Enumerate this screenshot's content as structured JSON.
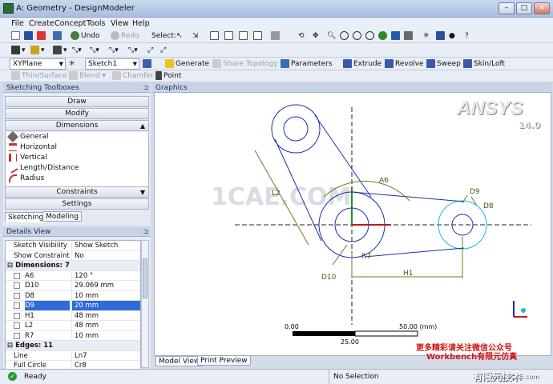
{
  "window": {
    "title": "A: Geometry - DesignModeler",
    "min": "–",
    "max": "□",
    "close": "×"
  },
  "menu": [
    "File",
    "Create",
    "Concept",
    "Tools",
    "View",
    "Help"
  ],
  "toolbar1": {
    "undo": "Undo",
    "redo": "Redo",
    "select": "Select:"
  },
  "toolbar2": {
    "plane": "XYPlane",
    "sketch": "Sketch1",
    "generate": "Generate",
    "share_topology": "Share Topology",
    "parameters": "Parameters",
    "extrude": "Extrude",
    "revolve": "Revolve",
    "sweep": "Sweep",
    "skin_loft": "Skin/Loft"
  },
  "toolbar3": {
    "thin_surface": "Thin/Surface",
    "blend": "Blend",
    "chamfer": "Chamfer",
    "point": "Point"
  },
  "toolboxes": {
    "header": "Sketching Toolboxes",
    "draw": "Draw",
    "modify": "Modify",
    "dimensions": "Dimensions",
    "dim_items": [
      "General",
      "Horizontal",
      "Vertical",
      "Length/Distance",
      "Radius"
    ],
    "constraints": "Constraints",
    "settings": "Settings",
    "tabs": [
      "Sketching",
      "Modeling"
    ]
  },
  "details": {
    "header": "Details View",
    "rows": [
      {
        "k": "Sketch Visibility",
        "v": "Show Sketch"
      },
      {
        "k": "Show Constraints?",
        "v": "No"
      }
    ],
    "dimensions_group": "Dimensions: 7",
    "dims": [
      {
        "k": "A6",
        "v": "120 °"
      },
      {
        "k": "D10",
        "v": "29.069 mm"
      },
      {
        "k": "D8",
        "v": "10 mm"
      },
      {
        "k": "D9",
        "v": "20 mm"
      },
      {
        "k": "H1",
        "v": "48 mm"
      },
      {
        "k": "L2",
        "v": "48 mm"
      },
      {
        "k": "R7",
        "v": "10 mm"
      }
    ],
    "edges_group": "Edges: 11",
    "edges": [
      {
        "k": "Line",
        "v": "Ln7"
      },
      {
        "k": "Full Circle",
        "v": "Cr8"
      }
    ]
  },
  "graphics": {
    "header": "Graphics",
    "logo": "ANSYS",
    "version": "14.0",
    "labels": {
      "A6": "A6",
      "L2": "L2",
      "D9": "D9",
      "D8": "D8",
      "R7": "R7",
      "D10": "D10",
      "H1": "H1"
    },
    "scale": {
      "start": "0.00",
      "end": "50.00 (mm)",
      "mid": "25.00"
    },
    "watermark": "1CAE.COM",
    "promo_line1": "更多精彩请关注微信公众号",
    "promo_line2": "Workbench有限元仿真",
    "tabs": [
      "Model View",
      "Print Preview"
    ]
  },
  "status": {
    "ready": "Ready",
    "selection": "No Selection",
    "corner": "有限元技术",
    "corner_url": "www.1CAE.com"
  },
  "colors": {
    "sketch": "#1a2fb0",
    "dim": "#6b7d1a",
    "accent": "#2f6bd8",
    "promo": "#d21414"
  }
}
